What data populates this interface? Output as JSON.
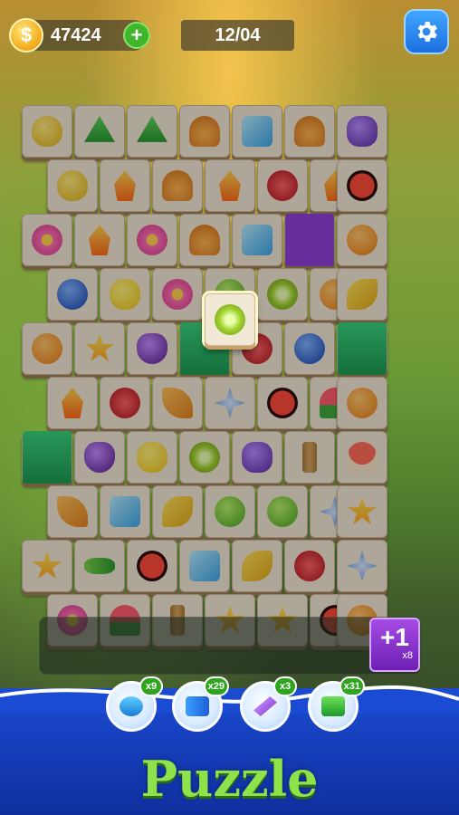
{
  "hud": {
    "coins": "47424",
    "coin_symbol": "$",
    "add_symbol": "+",
    "level": "12/04",
    "settings_icon": "gear-icon"
  },
  "board": {
    "tiles": [
      {
        "sym": "pear"
      },
      {
        "sym": "tree"
      },
      {
        "sym": "tree"
      },
      {
        "sym": "croissant"
      },
      {
        "sym": "ice"
      },
      {
        "sym": "croissant"
      },
      {
        "sym": "plum"
      },
      {
        "sym": "pear"
      },
      {
        "sym": "fire"
      },
      {
        "sym": "croissant"
      },
      {
        "sym": "fire"
      },
      {
        "sym": "cherry"
      },
      {
        "sym": "fire"
      },
      {
        "sym": "ladybug"
      },
      {
        "sym": "flower"
      },
      {
        "sym": "fire"
      },
      {
        "sym": "flower"
      },
      {
        "sym": "croissant"
      },
      {
        "sym": "ice"
      },
      {
        "sym": "purple-drop"
      },
      {
        "sym": "orange"
      },
      {
        "sym": "blueberry"
      },
      {
        "sym": "lemon"
      },
      {
        "sym": "flower"
      },
      {
        "sym": "apple"
      },
      {
        "sym": "kiwi"
      },
      {
        "sym": "orange"
      },
      {
        "sym": "banana"
      },
      {
        "sym": "orange"
      },
      {
        "sym": "star"
      },
      {
        "sym": "grape"
      },
      {
        "sym": "grass"
      },
      {
        "sym": "cherry"
      },
      {
        "sym": "blueberry"
      },
      {
        "sym": "grass"
      },
      {
        "sym": "fire"
      },
      {
        "sym": "cherry"
      },
      {
        "sym": "leaf"
      },
      {
        "sym": "snow"
      },
      {
        "sym": "ladybug"
      },
      {
        "sym": "melon"
      },
      {
        "sym": "orange"
      },
      {
        "sym": "grass"
      },
      {
        "sym": "grape"
      },
      {
        "sym": "lemon"
      },
      {
        "sym": "kiwi"
      },
      {
        "sym": "plum"
      },
      {
        "sym": "bamboo"
      },
      {
        "sym": "mushroom"
      },
      {
        "sym": "leaf"
      },
      {
        "sym": "ice"
      },
      {
        "sym": "banana"
      },
      {
        "sym": "apple"
      },
      {
        "sym": "apple"
      },
      {
        "sym": "snow"
      },
      {
        "sym": "star"
      },
      {
        "sym": "star"
      },
      {
        "sym": "pea"
      },
      {
        "sym": "ladybug"
      },
      {
        "sym": "ice"
      },
      {
        "sym": "banana"
      },
      {
        "sym": "cherry"
      },
      {
        "sym": "snow"
      },
      {
        "sym": "flower"
      },
      {
        "sym": "melon"
      },
      {
        "sym": "bamboo"
      },
      {
        "sym": "star"
      },
      {
        "sym": "star"
      },
      {
        "sym": "ladybug"
      },
      {
        "sym": "orange"
      }
    ],
    "selected_tile": {
      "sym": "kiwi"
    }
  },
  "tray": {
    "extra_slot_label": "+1",
    "extra_slot_count": "x8"
  },
  "powerups": [
    {
      "name": "undo-icon",
      "count": "x9"
    },
    {
      "name": "shuffle-icon",
      "count": "x29"
    },
    {
      "name": "magic-wand-icon",
      "count": "x3"
    },
    {
      "name": "hint-hand-icon",
      "count": "x31"
    }
  ],
  "title": "Puzzle",
  "colors": {
    "bottom_panel": "#1b4bd2",
    "title_green": "#8fe34a",
    "extra_slot_purple": "#8f3fd8",
    "coin_gold": "#f1a81a",
    "add_green": "#3fb62a"
  }
}
